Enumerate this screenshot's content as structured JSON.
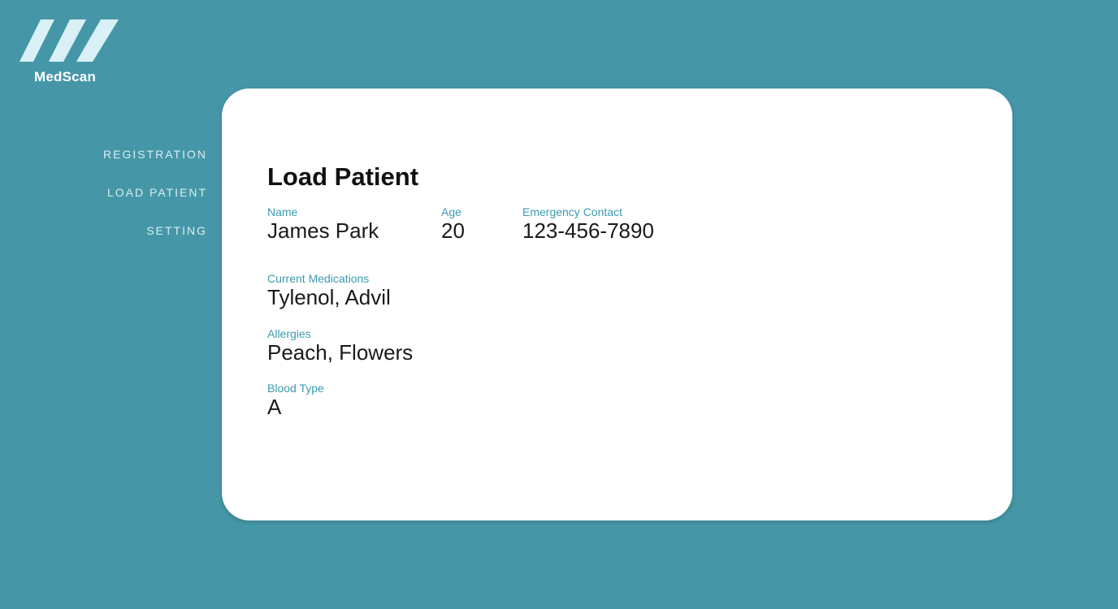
{
  "app": {
    "logo_text": "MedScan",
    "logo_icon": "three-slash-stripes-icon",
    "colors": {
      "background": "#4597a8",
      "card": "#ffffff",
      "label_accent": "#3b9aaf",
      "logo_stripes": "#d9f1f6",
      "nav_text": "#d8edf1"
    }
  },
  "nav": {
    "items": [
      {
        "label": "REGISTRATION"
      },
      {
        "label": "LOAD PATIENT"
      },
      {
        "label": "SETTING"
      }
    ]
  },
  "card": {
    "title": "Load Patient",
    "fields": {
      "name": {
        "label": "Name",
        "value": "James Park"
      },
      "age": {
        "label": "Age",
        "value": "20"
      },
      "emergency_contact": {
        "label": "Emergency Contact",
        "value": "123-456-7890"
      },
      "current_medications": {
        "label": "Current Medications",
        "value": "Tylenol, Advil"
      },
      "allergies": {
        "label": "Allergies",
        "value": "Peach, Flowers"
      },
      "blood_type": {
        "label": "Blood Type",
        "value": "A"
      }
    }
  }
}
